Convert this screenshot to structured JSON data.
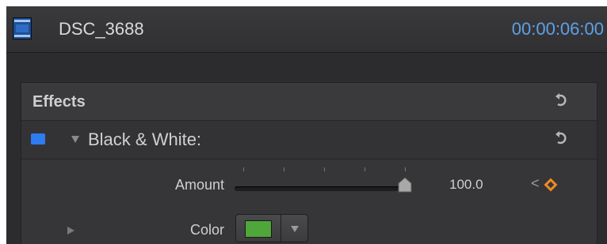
{
  "header": {
    "clip_name": "DSC_3688",
    "timecode": "00:00:06:00",
    "icon": "film-clip-icon"
  },
  "effects": {
    "label": "Effects",
    "reset_icon": "reset-arrow-icon"
  },
  "black_white": {
    "label": "Black & White:",
    "enabled": true,
    "expanded": true,
    "checkbox_color": "#2d7cf0",
    "reset_icon": "reset-arrow-icon"
  },
  "amount": {
    "label": "Amount",
    "value": "100.0",
    "slider_level": 1.0,
    "keyframe_prev_icon": "chevron-left-icon",
    "keyframe_icon": "keyframe-diamond-icon",
    "keyframe_color": "#ef8b25"
  },
  "color": {
    "label": "Color",
    "swatch": "#4fa63a",
    "expanded": false
  }
}
